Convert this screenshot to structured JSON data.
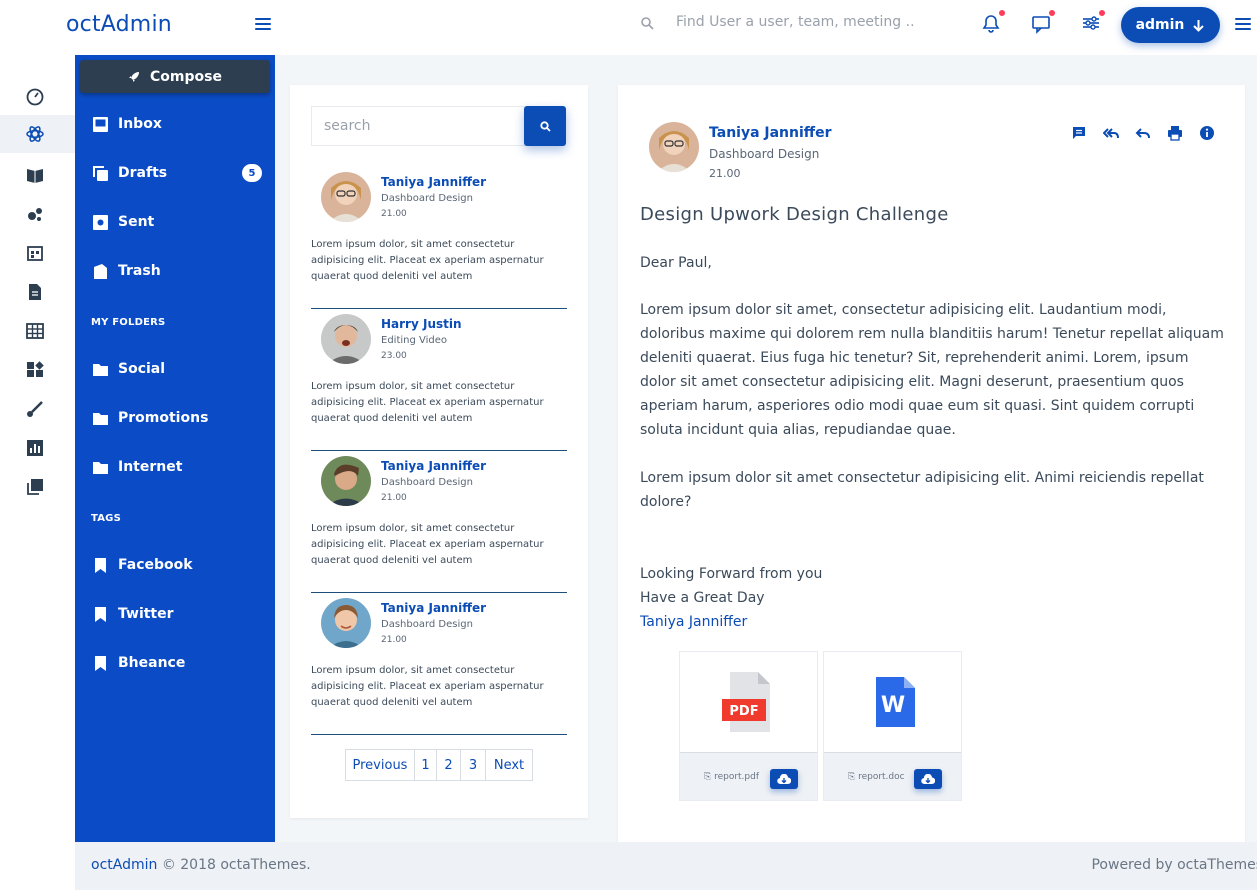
{
  "brand": "octAdmin",
  "header": {
    "search_placeholder": "Find User a user, team, meeting ..",
    "user_button": "admin"
  },
  "mini_nav": [
    "dashboard-icon",
    "atom-icon",
    "book-icon",
    "bubbles-icon",
    "calendar-icon",
    "document-icon",
    "table-icon",
    "widgets-icon",
    "brush-icon",
    "chart-icon",
    "copy-icon"
  ],
  "sidebar": {
    "compose": "Compose",
    "items": [
      {
        "label": "Inbox"
      },
      {
        "label": "Drafts",
        "badge": "5"
      },
      {
        "label": "Sent"
      },
      {
        "label": "Trash"
      }
    ],
    "folders_heading": "MY FOLDERS",
    "folders": [
      {
        "label": "Social"
      },
      {
        "label": "Promotions"
      },
      {
        "label": "Internet"
      }
    ],
    "tags_heading": "TAGS",
    "tags": [
      {
        "label": "Facebook"
      },
      {
        "label": "Twitter"
      },
      {
        "label": "Bheance"
      }
    ]
  },
  "mail_list": {
    "search_placeholder": "search",
    "items": [
      {
        "name": "Taniya Janniffer",
        "subject": "Dashboard Design",
        "time": "21.00",
        "snippet": "Lorem ipsum dolor, sit amet consectetur adipisicing elit. Placeat ex aperiam aspernatur quaerat quod deleniti vel autem"
      },
      {
        "name": "Harry Justin",
        "subject": "Editing Video",
        "time": "23.00",
        "snippet": "Lorem ipsum dolor, sit amet consectetur adipisicing elit. Placeat ex aperiam aspernatur quaerat quod deleniti vel autem"
      },
      {
        "name": "Taniya Janniffer",
        "subject": "Dashboard Design",
        "time": "21.00",
        "snippet": "Lorem ipsum dolor, sit amet consectetur adipisicing elit. Placeat ex aperiam aspernatur quaerat quod deleniti vel autem"
      },
      {
        "name": "Taniya Janniffer",
        "subject": "Dashboard Design",
        "time": "21.00",
        "snippet": "Lorem ipsum dolor, sit amet consectetur adipisicing elit. Placeat ex aperiam aspernatur quaerat quod deleniti vel autem"
      }
    ],
    "pagination": {
      "previous": "Previous",
      "pages": [
        "1",
        "2",
        "3"
      ],
      "next": "Next"
    }
  },
  "message": {
    "sender": "Taniya Janniffer",
    "sender_subtitle": "Dashboard Design",
    "time": "21.00",
    "title": "Design Upwork Design Challenge",
    "greeting": "Dear Paul,",
    "paragraph1": "Lorem ipsum dolor sit amet, consectetur adipisicing elit. Laudantium modi, doloribus maxime qui dolorem rem nulla blanditiis harum! Tenetur repellat aliquam deleniti quaerat. Eius fuga hic tenetur? Sit, reprehenderit animi. Lorem, ipsum dolor sit amet consectetur adipisicing elit. Magni deserunt, praesentium quos aperiam harum, asperiores odio modi quae eum sit quasi. Sint quidem corrupti soluta incidunt quia alias, repudiandae quae.",
    "paragraph2": "Lorem ipsum dolor sit amet consectetur adipisicing elit. Animi reiciendis repellat dolore?",
    "closing1": "Looking Forward from you",
    "closing2": "Have a Great Day",
    "signature": "Taniya Janniffer",
    "attachments": [
      {
        "file": "report.pdf",
        "badge": "PDF"
      },
      {
        "file": "report.doc",
        "badge": "W"
      }
    ]
  },
  "footer": {
    "brand": "octAdmin",
    "copyright": "© 2018 octaThemes.",
    "powered": "Powered by octaThemes"
  },
  "colors": {
    "accent": "#0b4cb5",
    "sidebar": "#0b4cc6",
    "compose": "#2c3e50",
    "notify_dot": "#ff3d5a"
  }
}
